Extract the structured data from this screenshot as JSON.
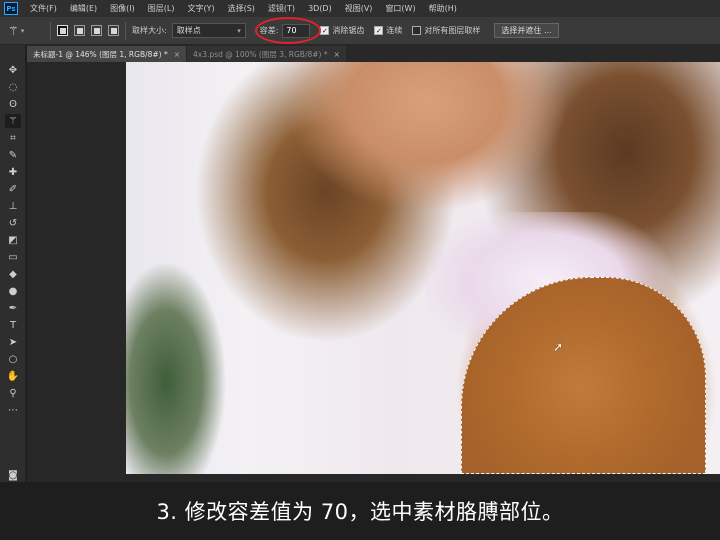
{
  "app": {
    "logo": "Ps"
  },
  "menu": [
    "文件(F)",
    "编辑(E)",
    "图像(I)",
    "图层(L)",
    "文字(Y)",
    "选择(S)",
    "滤镜(T)",
    "3D(D)",
    "视图(V)",
    "窗口(W)",
    "帮助(H)"
  ],
  "options": {
    "tool_icon": "magic-wand-icon",
    "sample_size_label": "取样大小:",
    "sample_size_value": "取样点",
    "tolerance_label": "容差:",
    "tolerance_value": "70",
    "antialias_label": "消除锯齿",
    "antialias_checked": true,
    "contiguous_label": "连续",
    "contiguous_checked": true,
    "all_layers_label": "对所有图层取样",
    "all_layers_checked": false,
    "select_mask_button": "选择并遮住 ...",
    "highlight_color": "#e0242a"
  },
  "tabs": [
    {
      "label": "未标题-1 @ 146% (图层 1, RGB/8#) *",
      "active": true
    },
    {
      "label": "4x3.psd @ 100% (图层 3, RGB/8#) *",
      "active": false
    }
  ],
  "colors": {
    "foreground": "#e00000",
    "background": "#000000"
  },
  "caption": "3. 修改容差值为 70，选中素材胳膊部位。"
}
